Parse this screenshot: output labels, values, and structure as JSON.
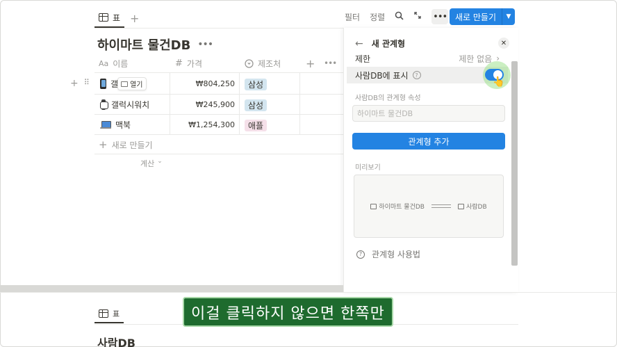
{
  "toolbar": {
    "view_tab": "표",
    "filter": "필터",
    "sort": "정렬",
    "new_button": "새로 만들기"
  },
  "db": {
    "title": "하이마트 물건DB",
    "columns": [
      {
        "label": "이름",
        "icon": "text-aa-icon",
        "prefix": "Aa"
      },
      {
        "label": "가격",
        "icon": "number-hash-icon",
        "prefix": "#"
      },
      {
        "label": "제조처",
        "icon": "select-icon"
      }
    ],
    "rows": [
      {
        "name": "갤럭",
        "price": "₩804,250",
        "maker": "삼성",
        "icon": "phone-icon",
        "open_label": "열기"
      },
      {
        "name": "갤럭시워치",
        "price": "₩245,900",
        "maker": "삼성",
        "icon": "watch-icon"
      },
      {
        "name": "맥북",
        "price": "₩1,254,300",
        "maker": "애플",
        "icon": "laptop-icon"
      }
    ],
    "new_row": "새로 만들기",
    "calculate": "계산"
  },
  "panel": {
    "title": "새 관계형",
    "limit_label": "제한",
    "limit_value": "제한 없음",
    "show_in_label": "사람DB에 표시",
    "show_in_on": true,
    "relation_prop_label": "사람DB의 관계형 속성",
    "relation_prop_placeholder": "하이마트 물건DB",
    "add_button": "관계형 추가",
    "preview_label": "미리보기",
    "preview_left": "하이마트 물건DB",
    "preview_right": "사람DB",
    "help": "관계형 사용법"
  },
  "bottom": {
    "view_tab": "표",
    "title": "사람DB"
  },
  "subtitle": "이걸 클릭하지 않으면 한쪽만",
  "colors": {
    "accent": "#2383e2",
    "tag_samsung_bg": "#d3e5ef",
    "tag_apple_bg": "#f5e0e9",
    "subtitle_bg": "#1e6b2e"
  }
}
